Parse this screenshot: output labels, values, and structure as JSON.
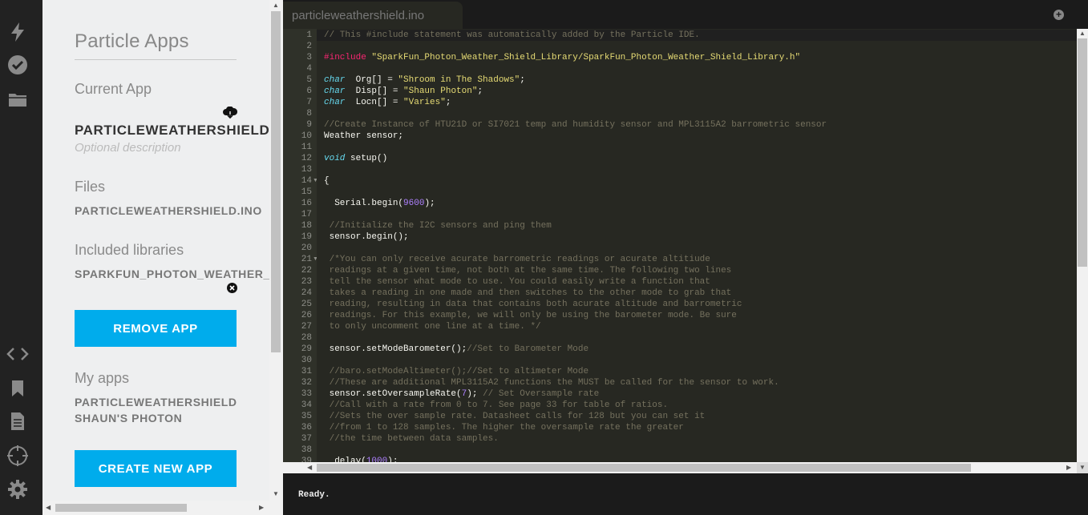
{
  "rail": {
    "top_icons": [
      "flash-icon",
      "verify-icon",
      "folder-icon"
    ],
    "bottom_icons": [
      "code-icon",
      "bookmark-icon",
      "document-icon",
      "target-icon",
      "gear-icon"
    ]
  },
  "panel": {
    "title": "Particle Apps",
    "current_app_label": "Current App",
    "current_app_name": "PARTICLEWEATHERSHIELD",
    "description_placeholder": "Optional description",
    "files_label": "Files",
    "file_name": "PARTICLEWEATHERSHIELD.INO",
    "libraries_label": "Included libraries",
    "library_name": "SPARKFUN_PHOTON_WEATHER_SHIELD_LIBRARY",
    "remove_button": "REMOVE APP",
    "my_apps_label": "My apps",
    "my_apps": [
      "PARTICLEWEATHERSHIELD",
      "SHAUN'S PHOTON"
    ],
    "create_button": "CREATE NEW APP"
  },
  "editor": {
    "tab_title": "particleweathershield.ino",
    "add_tab": "+",
    "lines": [
      {
        "n": "1",
        "fold": false,
        "segs": [
          [
            "cm",
            "// This #include statement was automatically added by the Particle IDE."
          ]
        ]
      },
      {
        "n": "2",
        "fold": false,
        "segs": []
      },
      {
        "n": "3",
        "fold": false,
        "segs": [
          [
            "kw",
            "#include "
          ],
          [
            "st",
            "\"SparkFun_Photon_Weather_Shield_Library/SparkFun_Photon_Weather_Shield_Library.h\""
          ]
        ]
      },
      {
        "n": "4",
        "fold": false,
        "segs": []
      },
      {
        "n": "5",
        "fold": false,
        "segs": [
          [
            "ty",
            "char"
          ],
          [
            "",
            "  Org[] = "
          ],
          [
            "st",
            "\"Shroom in The Shadows\""
          ],
          [
            "",
            ";"
          ]
        ]
      },
      {
        "n": "6",
        "fold": false,
        "segs": [
          [
            "ty",
            "char"
          ],
          [
            "",
            "  Disp[] = "
          ],
          [
            "st",
            "\"Shaun Photon\""
          ],
          [
            "",
            ";"
          ]
        ]
      },
      {
        "n": "7",
        "fold": false,
        "segs": [
          [
            "ty",
            "char"
          ],
          [
            "",
            "  Locn[] = "
          ],
          [
            "st",
            "\"Varies\""
          ],
          [
            "",
            ";"
          ]
        ]
      },
      {
        "n": "8",
        "fold": false,
        "segs": []
      },
      {
        "n": "9",
        "fold": false,
        "segs": [
          [
            "cm",
            "//Create Instance of HTU21D or SI7021 temp and humidity sensor and MPL3115A2 barrometric sensor"
          ]
        ]
      },
      {
        "n": "10",
        "fold": false,
        "segs": [
          [
            "",
            "Weather sensor;"
          ]
        ]
      },
      {
        "n": "11",
        "fold": false,
        "segs": []
      },
      {
        "n": "12",
        "fold": false,
        "segs": [
          [
            "ty",
            "void"
          ],
          [
            "",
            " setup()"
          ]
        ]
      },
      {
        "n": "13",
        "fold": false,
        "segs": []
      },
      {
        "n": "14",
        "fold": true,
        "segs": [
          [
            "",
            "{"
          ]
        ]
      },
      {
        "n": "15",
        "fold": false,
        "segs": []
      },
      {
        "n": "16",
        "fold": false,
        "segs": [
          [
            "",
            "  Serial.begin("
          ],
          [
            "nu",
            "9600"
          ],
          [
            "",
            ");"
          ]
        ]
      },
      {
        "n": "17",
        "fold": false,
        "segs": []
      },
      {
        "n": "18",
        "fold": false,
        "segs": [
          [
            "cm",
            " //Initialize the I2C sensors and ping them"
          ]
        ]
      },
      {
        "n": "19",
        "fold": false,
        "segs": [
          [
            "",
            " sensor.begin();"
          ]
        ]
      },
      {
        "n": "20",
        "fold": false,
        "segs": []
      },
      {
        "n": "21",
        "fold": true,
        "segs": [
          [
            "cm",
            " /*You can only receive acurate barrometric readings or acurate altitiude"
          ]
        ]
      },
      {
        "n": "22",
        "fold": false,
        "segs": [
          [
            "cm",
            " readings at a given time, not both at the same time. The following two lines"
          ]
        ]
      },
      {
        "n": "23",
        "fold": false,
        "segs": [
          [
            "cm",
            " tell the sensor what mode to use. You could easily write a function that"
          ]
        ]
      },
      {
        "n": "24",
        "fold": false,
        "segs": [
          [
            "cm",
            " takes a reading in one made and then switches to the other mode to grab that"
          ]
        ]
      },
      {
        "n": "25",
        "fold": false,
        "segs": [
          [
            "cm",
            " reading, resulting in data that contains both acurate altitude and barrometric"
          ]
        ]
      },
      {
        "n": "26",
        "fold": false,
        "segs": [
          [
            "cm",
            " readings. For this example, we will only be using the barometer mode. Be sure"
          ]
        ]
      },
      {
        "n": "27",
        "fold": false,
        "segs": [
          [
            "cm",
            " to only uncomment one line at a time. */"
          ]
        ]
      },
      {
        "n": "28",
        "fold": false,
        "segs": []
      },
      {
        "n": "29",
        "fold": false,
        "segs": [
          [
            "",
            " sensor.setModeBarometer();"
          ],
          [
            "cm",
            "//Set to Barometer Mode"
          ]
        ]
      },
      {
        "n": "30",
        "fold": false,
        "segs": []
      },
      {
        "n": "31",
        "fold": false,
        "segs": [
          [
            "cm",
            " //baro.setModeAltimeter();//Set to altimeter Mode"
          ]
        ]
      },
      {
        "n": "32",
        "fold": false,
        "segs": [
          [
            "cm",
            " //These are additional MPL3115A2 functions the MUST be called for the sensor to work."
          ]
        ]
      },
      {
        "n": "33",
        "fold": false,
        "segs": [
          [
            "",
            " sensor.setOversampleRate("
          ],
          [
            "nu",
            "7"
          ],
          [
            "",
            "); "
          ],
          [
            "cm",
            "// Set Oversample rate"
          ]
        ]
      },
      {
        "n": "34",
        "fold": false,
        "segs": [
          [
            "cm",
            " //Call with a rate from 0 to 7. See page 33 for table of ratios."
          ]
        ]
      },
      {
        "n": "35",
        "fold": false,
        "segs": [
          [
            "cm",
            " //Sets the over sample rate. Datasheet calls for 128 but you can set it"
          ]
        ]
      },
      {
        "n": "36",
        "fold": false,
        "segs": [
          [
            "cm",
            " //from 1 to 128 samples. The higher the oversample rate the greater"
          ]
        ]
      },
      {
        "n": "37",
        "fold": false,
        "segs": [
          [
            "cm",
            " //the time between data samples."
          ]
        ]
      },
      {
        "n": "38",
        "fold": false,
        "segs": []
      },
      {
        "n": "39",
        "fold": false,
        "segs": [
          [
            "",
            "  delay("
          ],
          [
            "nu",
            "1000"
          ],
          [
            "",
            ");"
          ]
        ]
      },
      {
        "n": "40",
        "fold": false,
        "segs": []
      }
    ]
  },
  "status": {
    "text": "Ready."
  }
}
